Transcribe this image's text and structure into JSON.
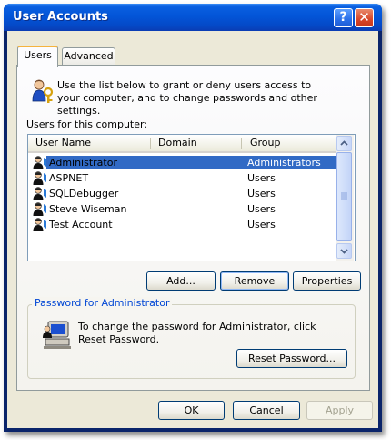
{
  "window": {
    "title": "User Accounts"
  },
  "titlebar": {
    "help_glyph": "?",
    "close_glyph": "✕"
  },
  "tabs": [
    {
      "label": "Users",
      "active": true
    },
    {
      "label": "Advanced",
      "active": false
    }
  ],
  "intro": {
    "text": "Use the list below to grant or deny users access to your computer, and to change passwords and other settings."
  },
  "users_label": "Users for this computer:",
  "columns": [
    "User Name",
    "Domain",
    "Group"
  ],
  "users": [
    {
      "name": "Administrator",
      "domain": "",
      "group": "Administrators",
      "selected": true
    },
    {
      "name": "ASPNET",
      "domain": "",
      "group": "Users",
      "selected": false
    },
    {
      "name": "SQLDebugger",
      "domain": "",
      "group": "Users",
      "selected": false
    },
    {
      "name": "Steve Wiseman",
      "domain": "",
      "group": "Users",
      "selected": false
    },
    {
      "name": "Test Account",
      "domain": "",
      "group": "Users",
      "selected": false
    }
  ],
  "list_buttons": {
    "add": "Add...",
    "remove": "Remove",
    "properties": "Properties"
  },
  "password_group": {
    "title": "Password for Administrator",
    "text": "To change the password for Administrator, click Reset Password.",
    "reset_label": "Reset Password..."
  },
  "dialog_buttons": {
    "ok": "OK",
    "cancel": "Cancel",
    "apply": "Apply"
  },
  "colors": {
    "selection": "#316ac5",
    "titlebar": "#0355d8",
    "face": "#ece9d8"
  }
}
